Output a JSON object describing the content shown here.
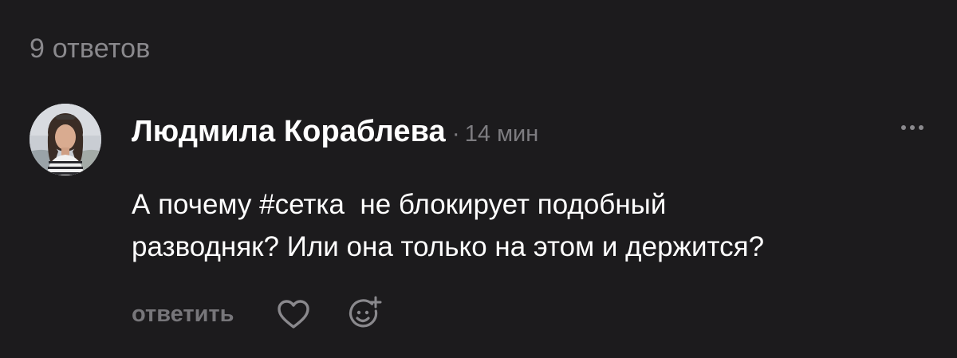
{
  "thread": {
    "replies_count": "9 ответов"
  },
  "comment": {
    "author": "Людмила Кораблева",
    "separator": "·",
    "time_ago": "14 мин",
    "text": "А почему #сетка  не блокирует подобный\nразводняк? Или она только на этом и держится?",
    "actions": {
      "reply_label": "ответить",
      "like_icon": "heart-icon",
      "react_icon": "emoji-add-icon",
      "more_icon": "more-dots-icon"
    }
  },
  "colors": {
    "background": "#1c1b1d",
    "primary_text": "#ffffff",
    "secondary_text": "#8a898d",
    "icon": "#8a898d"
  }
}
